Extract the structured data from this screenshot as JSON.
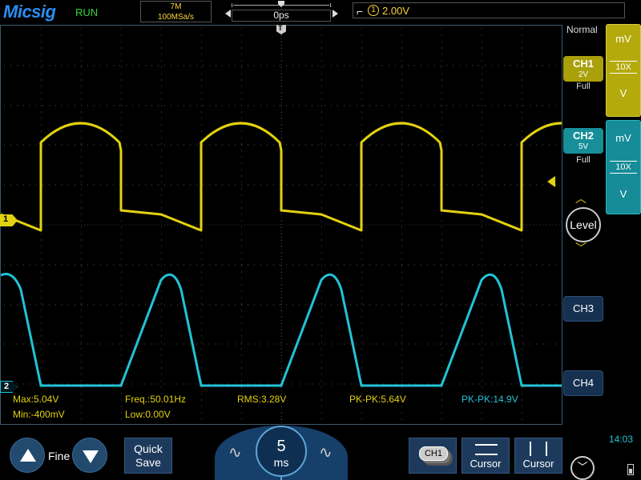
{
  "topbar": {
    "brand": "Micsig",
    "run_state": "RUN",
    "memory_depth": "7M",
    "sample_rate": "100MSa/s",
    "time_offset": "0ps",
    "trigger_source": "1",
    "trigger_level": "2.00V"
  },
  "screen": {
    "trigger_position_label": "T",
    "ch1_marker": "1",
    "ch2_marker": "2",
    "measurements": {
      "ch1_max": "Max:5.04V",
      "ch1_min": "Min:-400mV",
      "ch1_freq": "Freq.:50.01Hz",
      "ch1_low": "Low:0.00V",
      "ch1_rms": "RMS:3.28V",
      "ch1_pkpk": "PK-PK:5.64V",
      "ch2_pkpk": "PK-PK:14.9V"
    }
  },
  "right_panel": {
    "acquire_mode": "Normal",
    "ch1": {
      "label": "CH1",
      "scale": "2V",
      "bandwidth": "Full",
      "unit_top": "mV",
      "probe": "10X",
      "unit_bottom": "V"
    },
    "ch2": {
      "label": "CH2",
      "scale": "5V",
      "bandwidth": "Full",
      "unit_top": "mV",
      "probe": "10X",
      "unit_bottom": "V"
    },
    "level_label": "Level",
    "ch3_label": "CH3",
    "ch4_label": "CH4"
  },
  "bottom_bar": {
    "fine_label": "Fine",
    "quick_save_line1": "Quick",
    "quick_save_line2": "Save",
    "timebase_value": "5",
    "timebase_unit": "ms",
    "ch1_badge": "CH1",
    "cursor1_label": "Cursor",
    "cursor2_label": "Cursor",
    "clock": "14:03"
  },
  "colors": {
    "ch1": "#e3d20f",
    "ch2": "#22c3d6",
    "brand": "#2b8df0",
    "run": "#35d63a"
  }
}
